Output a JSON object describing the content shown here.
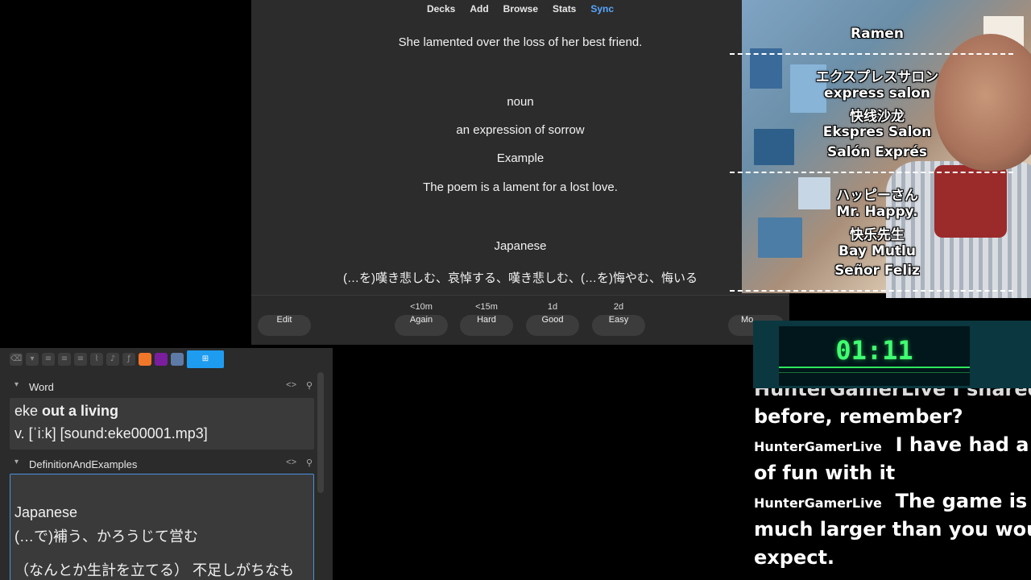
{
  "nav": [
    "Decks",
    "Add",
    "Browse",
    "Stats",
    "Sync"
  ],
  "card_lines": [
    "She lamented over the loss of her best friend.",
    "noun",
    "an expression of sorrow",
    "Example",
    "The poem is a lament for a lost love.",
    "Japanese",
    "(…を)嘆き悲しむ、哀悼する、嘆き悲しむ、(…を)悔やむ、悔いる"
  ],
  "answer_bar": {
    "edit_label": "Edit",
    "more_label": "Mo",
    "buttons": [
      {
        "label": "Again",
        "interval": "<10m"
      },
      {
        "label": "Hard",
        "interval": "<15m"
      },
      {
        "label": "Good",
        "interval": "1d"
      },
      {
        "label": "Easy",
        "interval": "2d"
      }
    ]
  },
  "editor": {
    "fields": [
      {
        "name": "Word",
        "lines_prefix": "eke ",
        "lines_bold": "out a living",
        "line2": "v. [ˈiːk] [sound:eke00001.mp3]"
      },
      {
        "name": "DefinitionAndExamples",
        "line1": "Japanese",
        "line2": "(…で)補う、かろうじて営む",
        "line3": "（なんとか生計を立てる） 不足しがちなも"
      }
    ],
    "code_icon": "<>",
    "pin_icon": "pin-icon"
  },
  "webcam_overlay": {
    "group1": [
      "Ramen"
    ],
    "group2": [
      "エクスプレスサロン",
      "express salon",
      "快线沙龙",
      "Ekspres Salon",
      "Salón Exprés"
    ],
    "group3": [
      "ハッピーさん",
      "Mr. Happy.",
      "快乐先生",
      "Bay Mutlu",
      "Señor Feliz"
    ]
  },
  "timer": "01:11",
  "chat": {
    "partial_top": "HunterGamerLive  I shared this",
    "lines": [
      {
        "text": "before, remember?"
      },
      {
        "user": "HunterGamerLive",
        "text": "I have had a lot"
      },
      {
        "text": "of fun with it"
      },
      {
        "user": "HunterGamerLive",
        "text": "The game is"
      },
      {
        "text": "much larger than you would"
      },
      {
        "text": "expect."
      }
    ]
  },
  "colors": {
    "sync_link": "#58a6ff",
    "timer_green": "#40ff70",
    "editor_accent": "#1e9cf0",
    "focus_border": "#4a90e2"
  }
}
